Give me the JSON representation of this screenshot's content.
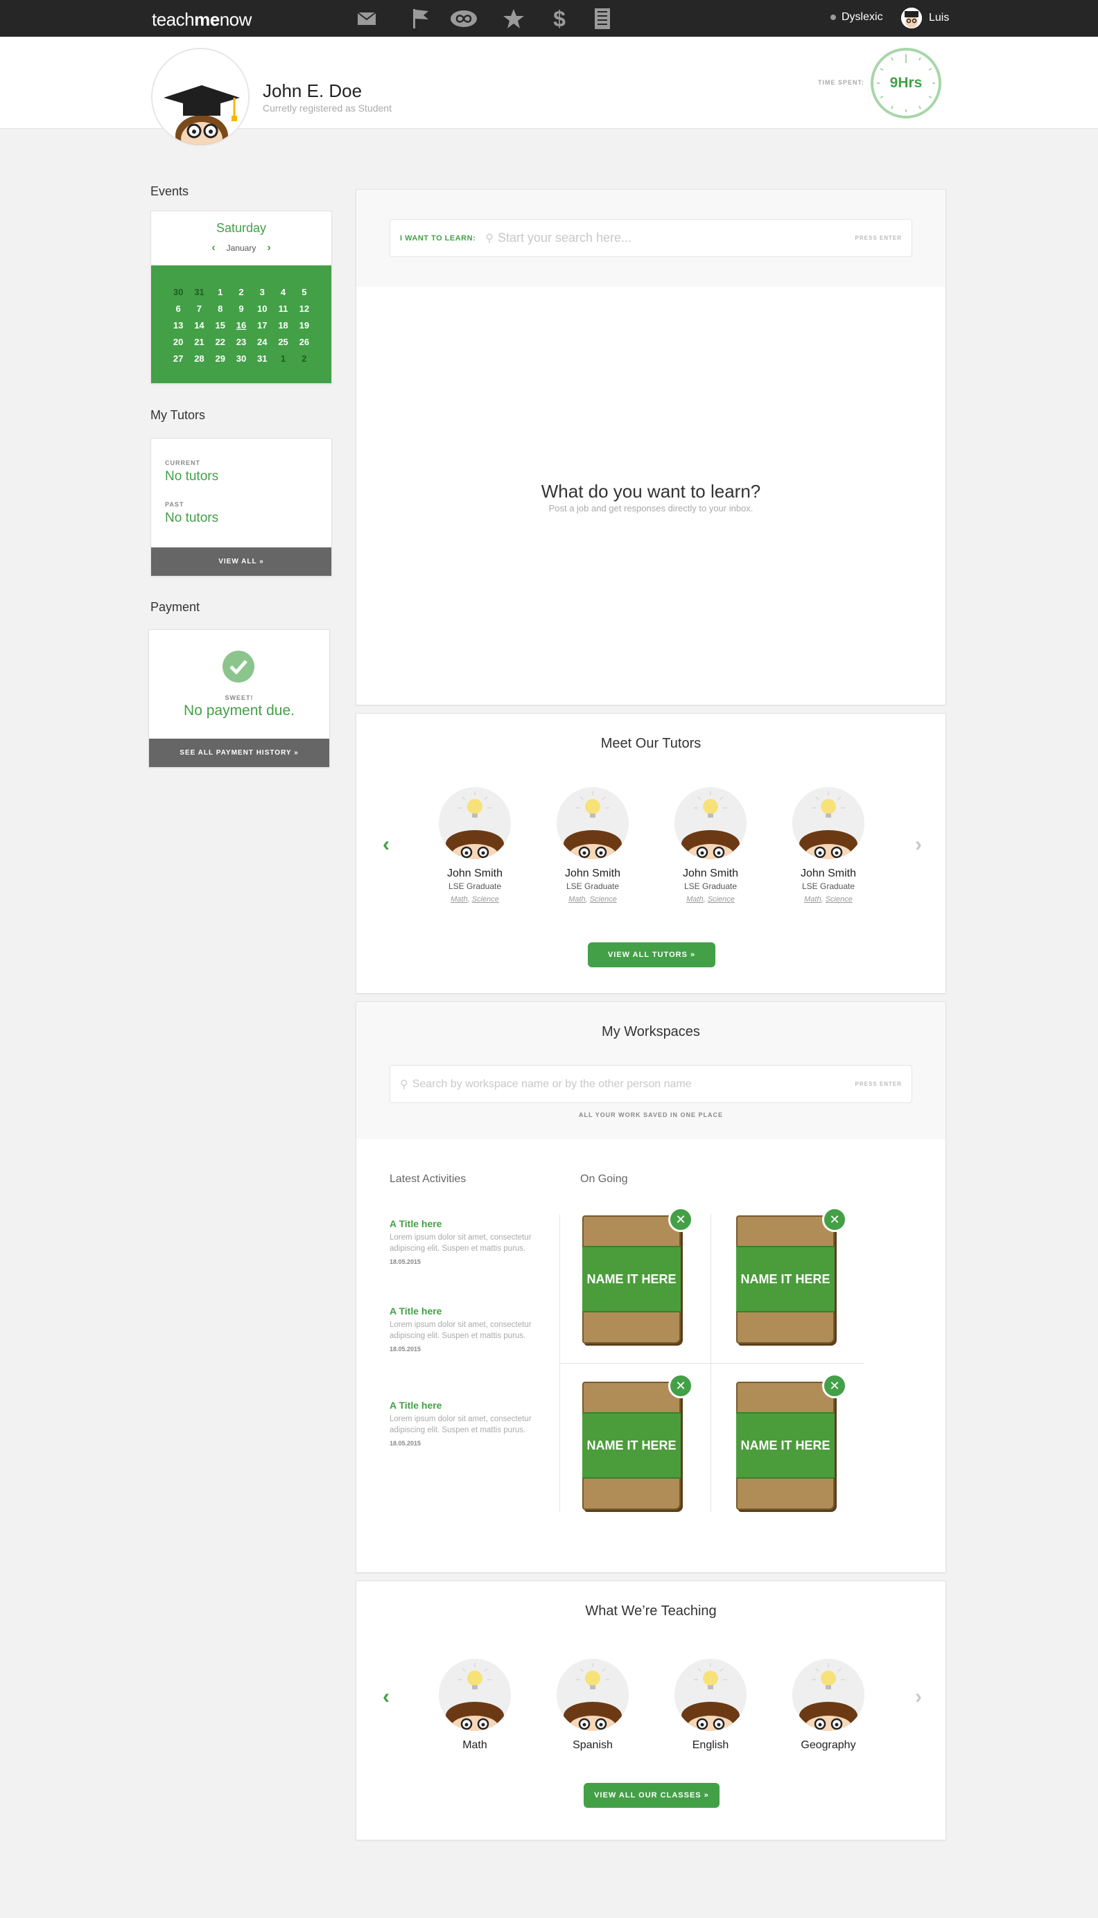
{
  "brand": {
    "prefix": "teach",
    "bold": "me",
    "suffix": "now"
  },
  "topbar": {
    "icons": [
      "mail-icon",
      "flag-icon",
      "infinity-icon",
      "star-icon",
      "dollar-icon",
      "notebook-icon"
    ],
    "dyslexic_label": "Dyslexic",
    "user_name": "Luis"
  },
  "profile": {
    "name": "John E. Doe",
    "subtitle": "Curretly registered as Student",
    "time_label": "TIME SPENT:",
    "time_value": "9Hrs"
  },
  "events": {
    "title": "Events",
    "day": "Saturday",
    "month": "January",
    "weeks": [
      [
        "30",
        "31",
        "1",
        "2",
        "3",
        "4",
        "5"
      ],
      [
        "6",
        "7",
        "8",
        "9",
        "10",
        "11",
        "12"
      ],
      [
        "13",
        "14",
        "15",
        "16",
        "17",
        "18",
        "19"
      ],
      [
        "20",
        "21",
        "22",
        "23",
        "24",
        "25",
        "26"
      ],
      [
        "27",
        "28",
        "29",
        "30",
        "31",
        "1",
        "2"
      ]
    ]
  },
  "tutors_side": {
    "title": "My Tutors",
    "current_label": "CURRENT",
    "current_value": "No tutors",
    "past_label": "PAST",
    "past_value": "No tutors",
    "view_all": "VIEW ALL »"
  },
  "payment": {
    "title": "Payment",
    "sweet": "SWEET!",
    "value": "No payment due.",
    "history": "SEE ALL PAYMENT HISTORY »"
  },
  "learn": {
    "search_label": "I WANT TO LEARN:",
    "placeholder": "Start your search here...",
    "press_enter": "PRESS ENTER",
    "heading": "What do you want to learn?",
    "sub": "Post a job and get responses directly to your inbox."
  },
  "meet_tutors": {
    "title": "Meet Our Tutors",
    "tutors": [
      {
        "name": "John Smith",
        "degree": "LSE Graduate",
        "tag1": "Math",
        "tag2": "Science"
      },
      {
        "name": "John Smith",
        "degree": "LSE Graduate",
        "tag1": "Math",
        "tag2": "Science"
      },
      {
        "name": "John Smith",
        "degree": "LSE Graduate",
        "tag1": "Math",
        "tag2": "Science"
      },
      {
        "name": "John Smith",
        "degree": "LSE Graduate",
        "tag1": "Math",
        "tag2": "Science"
      }
    ],
    "button": "VIEW ALL TUTORS »"
  },
  "workspaces": {
    "title": "My Workspaces",
    "placeholder": "Search by workspace name or by the other person name",
    "press_enter": "PRESS ENTER",
    "caption": "ALL YOUR WORK SAVED IN ONE PLACE",
    "latest_title": "Latest Activities",
    "ongoing_title": "On Going",
    "activities": [
      {
        "title": "A Title here",
        "body": "Lorem ipsum dolor sit amet, consectetur adipiscing elit. Suspen et mattis purus.",
        "date": "18.05.2015"
      },
      {
        "title": "A Title here",
        "body": "Lorem ipsum dolor sit amet, consectetur adipiscing elit. Suspen et mattis purus.",
        "date": "18.05.2015"
      },
      {
        "title": "A Title here",
        "body": "Lorem ipsum dolor sit amet, consectetur adipiscing elit. Suspen et mattis purus.",
        "date": "18.05.2015"
      }
    ],
    "notebooks": [
      "NAME IT HERE",
      "NAME IT HERE",
      "NAME IT HERE",
      "NAME IT HERE"
    ]
  },
  "teaching": {
    "title": "What We’re Teaching",
    "classes": [
      "Math",
      "Spanish",
      "English",
      "Geography"
    ],
    "button": "VIEW ALL OUR CLASSES »"
  },
  "colors": {
    "accent": "#43a047",
    "topbar": "#262626",
    "background": "#f2f2f2"
  }
}
